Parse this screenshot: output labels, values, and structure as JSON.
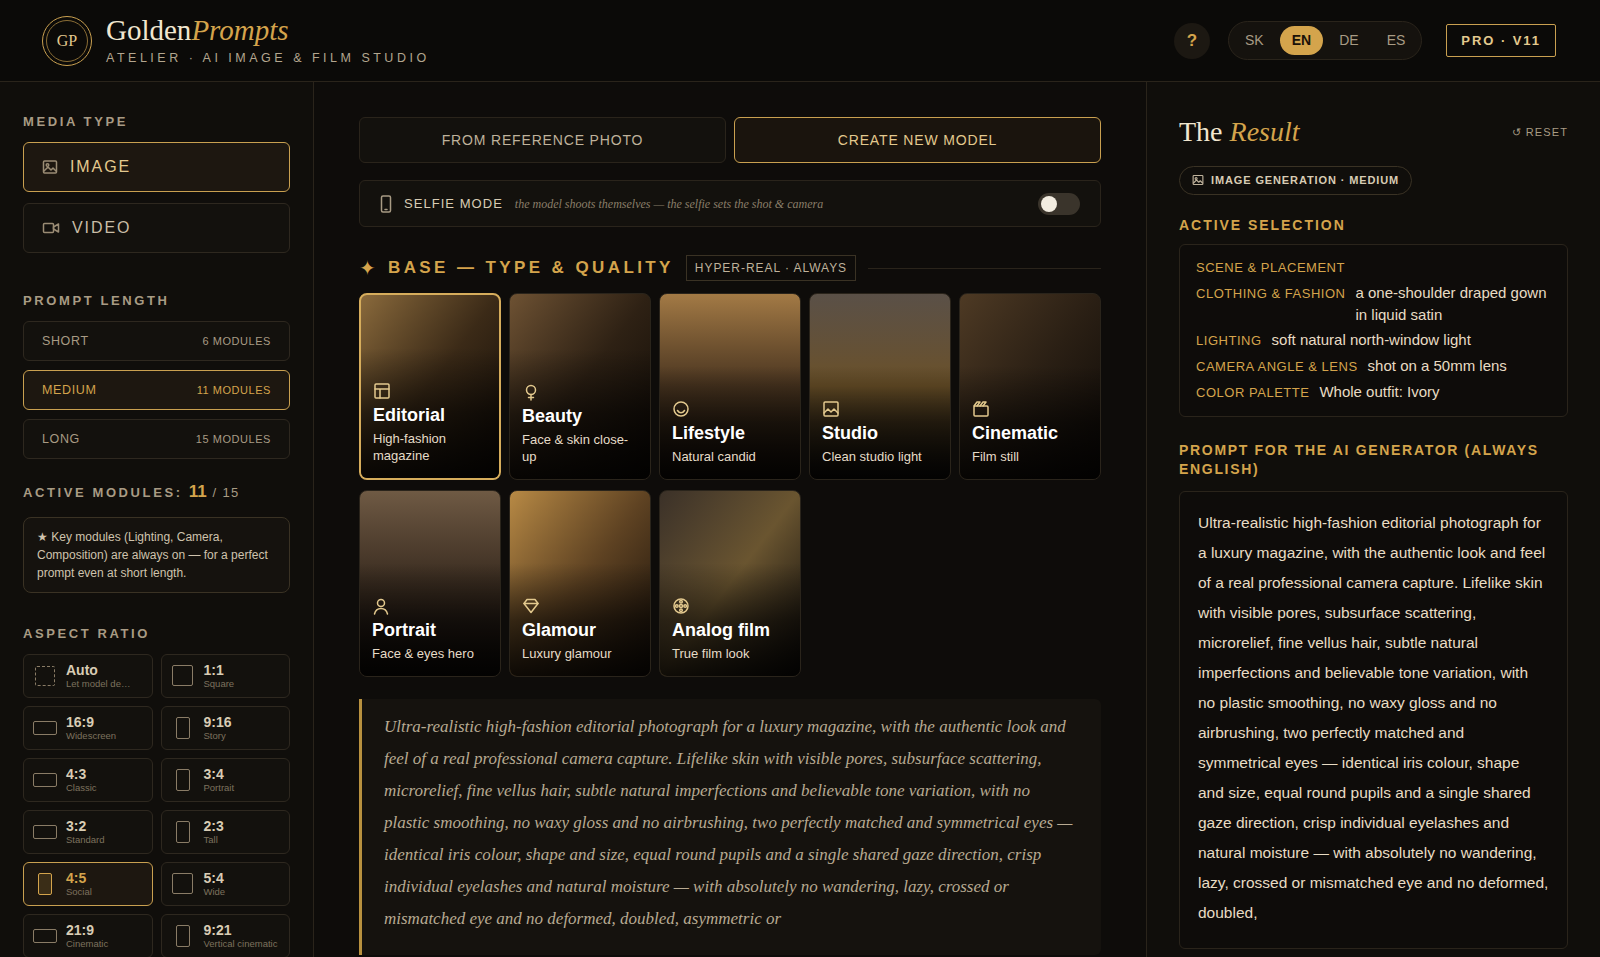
{
  "header": {
    "logo": "GP",
    "brand": "Golden",
    "brand_accent": "Prompts",
    "subtitle": "ATELIER · AI IMAGE & FILM STUDIO",
    "help": "?",
    "languages": [
      {
        "label": "SK",
        "selected": false
      },
      {
        "label": "EN",
        "selected": true
      },
      {
        "label": "DE",
        "selected": false
      },
      {
        "label": "ES",
        "selected": false
      }
    ],
    "plan": "PRO · V11"
  },
  "sidebar": {
    "media_title": "MEDIA TYPE",
    "media": [
      {
        "label": "IMAGE",
        "selected": true,
        "kind": "image"
      },
      {
        "label": "VIDEO",
        "selected": false,
        "kind": "video"
      }
    ],
    "length_title": "PROMPT LENGTH",
    "lengths": [
      {
        "label": "SHORT",
        "modules": "6 MODULES",
        "selected": false
      },
      {
        "label": "MEDIUM",
        "modules": "11 MODULES",
        "selected": true
      },
      {
        "label": "LONG",
        "modules": "15 MODULES",
        "selected": false
      }
    ],
    "active_modules": {
      "label": "ACTIVE MODULES:",
      "count": "11",
      "total": "/ 15"
    },
    "note": "★ Key modules (Lighting, Camera, Composition) are always on — for a perfect prompt even at short length.",
    "aspect_title": "ASPECT RATIO",
    "ratios": [
      {
        "ratio": "Auto",
        "caption": "Let model de…",
        "selected": false,
        "kind": "auto"
      },
      {
        "ratio": "1:1",
        "caption": "Square",
        "selected": false,
        "kind": "square"
      },
      {
        "ratio": "16:9",
        "caption": "Widescreen",
        "selected": false,
        "kind": "landscape"
      },
      {
        "ratio": "9:16",
        "caption": "Story",
        "selected": false,
        "kind": "portrait"
      },
      {
        "ratio": "4:3",
        "caption": "Classic",
        "selected": false,
        "kind": "landscape"
      },
      {
        "ratio": "3:4",
        "caption": "Portrait",
        "selected": false,
        "kind": "portrait"
      },
      {
        "ratio": "3:2",
        "caption": "Standard",
        "selected": false,
        "kind": "landscape"
      },
      {
        "ratio": "2:3",
        "caption": "Tall",
        "selected": false,
        "kind": "portrait"
      },
      {
        "ratio": "4:5",
        "caption": "Social",
        "selected": true,
        "kind": "portrait"
      },
      {
        "ratio": "5:4",
        "caption": "Wide",
        "selected": false,
        "kind": "square"
      },
      {
        "ratio": "21:9",
        "caption": "Cinematic",
        "selected": false,
        "kind": "landscape"
      },
      {
        "ratio": "9:21",
        "caption": "Vertical cinematic",
        "selected": false,
        "kind": "portrait"
      }
    ]
  },
  "main": {
    "tabs": [
      {
        "label": "FROM REFERENCE PHOTO",
        "selected": false
      },
      {
        "label": "CREATE NEW MODEL",
        "selected": true
      }
    ],
    "selfie": {
      "label": "SELFIE MODE",
      "hint": "the model shoots themselves — the selfie sets the shot & camera",
      "on": false
    },
    "section": {
      "icon": "✦",
      "title": "BASE — TYPE & QUALITY",
      "badge": "HYPER-REAL · ALWAYS"
    },
    "styles": [
      {
        "title": "Editorial",
        "subtitle": "High-fashion magazine",
        "selected": true,
        "kind": "editorial"
      },
      {
        "title": "Beauty",
        "subtitle": "Face & skin close-up",
        "selected": false,
        "kind": "beauty"
      },
      {
        "title": "Lifestyle",
        "subtitle": "Natural candid",
        "selected": false,
        "kind": "lifestyle"
      },
      {
        "title": "Studio",
        "subtitle": "Clean studio light",
        "selected": false,
        "kind": "studio"
      },
      {
        "title": "Cinematic",
        "subtitle": "Film still",
        "selected": false,
        "kind": "cinematic"
      },
      {
        "title": "Portrait",
        "subtitle": "Face & eyes hero",
        "selected": false,
        "kind": "portrait"
      },
      {
        "title": "Glamour",
        "subtitle": "Luxury glamour",
        "selected": false,
        "kind": "glamour"
      },
      {
        "title": "Analog film",
        "subtitle": "True film look",
        "selected": false,
        "kind": "analog"
      }
    ],
    "preview": "Ultra-realistic high-fashion editorial photograph for a luxury magazine, with the authentic look and feel of a real professional camera capture. Lifelike skin with visible pores, subsurface scattering, microrelief, fine vellus hair, subtle natural imperfections and believable tone variation, with no plastic smoothing, no waxy gloss and no airbrushing, two perfectly matched and symmetrical eyes — identical iris colour, shape and size, equal round pupils and a single shared gaze direction, crisp individual eyelashes and natural moisture — with absolutely no wandering, lazy, crossed or mismatched eye and no deformed, doubled, asymmetric or"
  },
  "result": {
    "title": "The",
    "title_accent": "Result",
    "reset": "↺ RESET",
    "badge": "IMAGE GENERATION · MEDIUM",
    "selection_title": "ACTIVE SELECTION",
    "selection": [
      {
        "label": "SCENE & PLACEMENT"
      },
      {
        "label": "CLOTHING & FASHION",
        "value": "a one-shoulder draped gown in liquid satin"
      },
      {
        "label": "LIGHTING",
        "value": "soft natural north-window light"
      },
      {
        "label": "CAMERA ANGLE & LENS",
        "value": "shot on a 50mm lens"
      },
      {
        "label": "COLOR PALETTE",
        "value": "Whole outfit: Ivory"
      }
    ],
    "prompt_title": "PROMPT FOR THE AI GENERATOR (ALWAYS ENGLISH)",
    "prompt": "Ultra-realistic high-fashion editorial photograph for a luxury magazine, with the authentic look and feel of a real professional camera capture. Lifelike skin with visible pores, subsurface scattering, microrelief, fine vellus hair, subtle natural imperfections and believable tone variation, with no plastic smoothing, no waxy gloss and no airbrushing, two perfectly matched and symmetrical eyes — identical iris colour, shape and size, equal round pupils and a single shared gaze direction, crisp individual eyelashes and natural moisture — with absolutely no wandering, lazy, crossed or mismatched eye and no deformed, doubled,"
  }
}
